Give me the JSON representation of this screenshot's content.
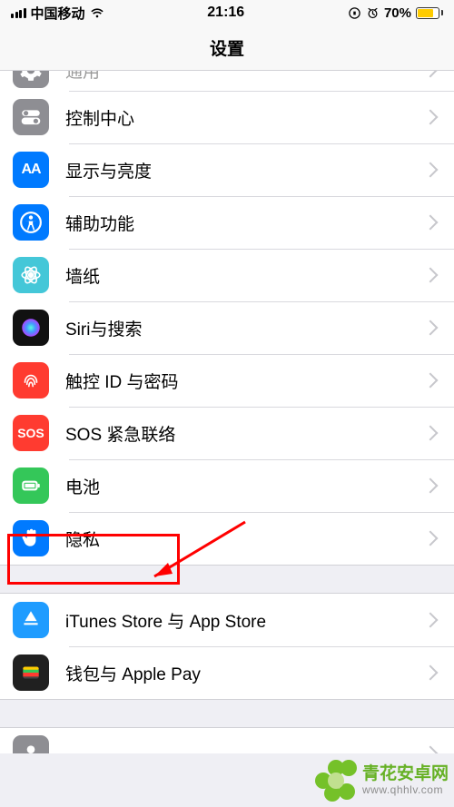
{
  "status_bar": {
    "carrier": "中国移动",
    "time": "21:16",
    "battery_pct": "70%"
  },
  "page_title": "设置",
  "groups": [
    {
      "rows": [
        {
          "icon": "general",
          "label": "通用",
          "partial_top": true
        },
        {
          "icon": "control",
          "label": "控制中心"
        },
        {
          "icon": "display",
          "label": "显示与亮度"
        },
        {
          "icon": "access",
          "label": "辅助功能"
        },
        {
          "icon": "wallpaper",
          "label": "墙纸"
        },
        {
          "icon": "siri",
          "label": "Siri与搜索"
        },
        {
          "icon": "touchid",
          "label": "触控 ID 与密码"
        },
        {
          "icon": "sos",
          "label": "SOS 紧急联络"
        },
        {
          "icon": "battery",
          "label": "电池"
        },
        {
          "icon": "privacy",
          "label": "隐私",
          "highlighted": true
        }
      ]
    },
    {
      "rows": [
        {
          "icon": "itunes",
          "label": "iTunes Store 与 App Store"
        },
        {
          "icon": "wallet",
          "label": "钱包与 Apple Pay"
        }
      ]
    },
    {
      "rows": [
        {
          "icon": "unknown",
          "label": "",
          "partial_bottom": true
        }
      ]
    }
  ],
  "annotation": {
    "highlight_row": "privacy",
    "arrow_points_to": "privacy"
  },
  "watermark": {
    "line1": "青花安卓网",
    "line2": "www.qhhlv.com"
  },
  "icon_text": {
    "display": "AA",
    "sos": "SOS"
  }
}
